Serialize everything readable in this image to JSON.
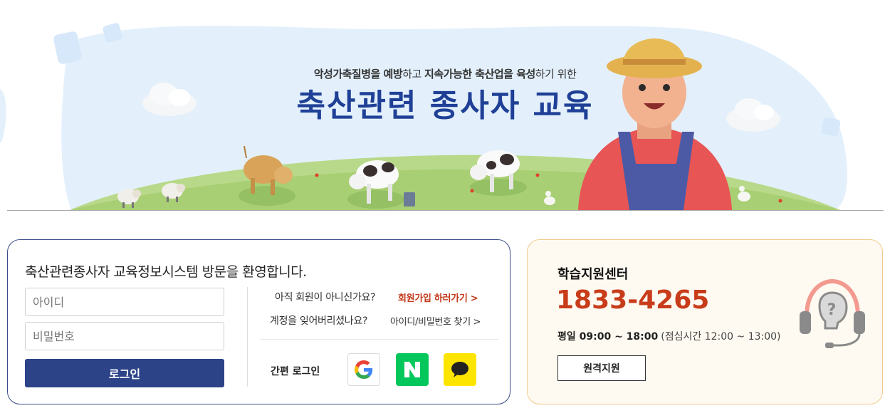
{
  "banner": {
    "subtitle_parts": [
      {
        "text": "악성가축질병을 예방",
        "bold": true
      },
      {
        "text": "하고 ",
        "bold": false
      },
      {
        "text": "지속가능한 축산업을 육성",
        "bold": true
      },
      {
        "text": "하기 위한",
        "bold": false
      }
    ],
    "title": "축산관련 종사자 교육"
  },
  "login": {
    "welcome": "축산관련종사자 교육정보시스템 방문을 환영합니다.",
    "id_placeholder": "아이디",
    "pw_placeholder": "비밀번호",
    "login_button": "로그인",
    "join_question": "아직 회원이 아니신가요?",
    "join_link": "회원가입 하러가기 >",
    "find_question": "계정을 잊어버리셨나요?",
    "find_link": "아이디/비밀번호 찾기 >",
    "easy_login_label": "간편 로그인",
    "social": [
      {
        "name": "google",
        "icon": "google-logo-icon"
      },
      {
        "name": "naver",
        "icon": "naver-logo-icon"
      },
      {
        "name": "kakao",
        "icon": "kakao-talk-icon"
      }
    ]
  },
  "support": {
    "title": "학습지원센터",
    "phone": "1833-4265",
    "hours": "평일 09:00 ~ 18:00",
    "lunch": "(점심시간 12:00 ~ 13:00)",
    "remote_button": "원격지원",
    "icon": "headset-question-icon"
  },
  "colors": {
    "primary": "#2c4388",
    "title_blue": "#1f4096",
    "accent_red": "#c83c1a",
    "naver_green": "#03c75a",
    "kakao_yellow": "#fee500",
    "support_bg": "#fffaf1",
    "support_border": "#f1c98c"
  }
}
